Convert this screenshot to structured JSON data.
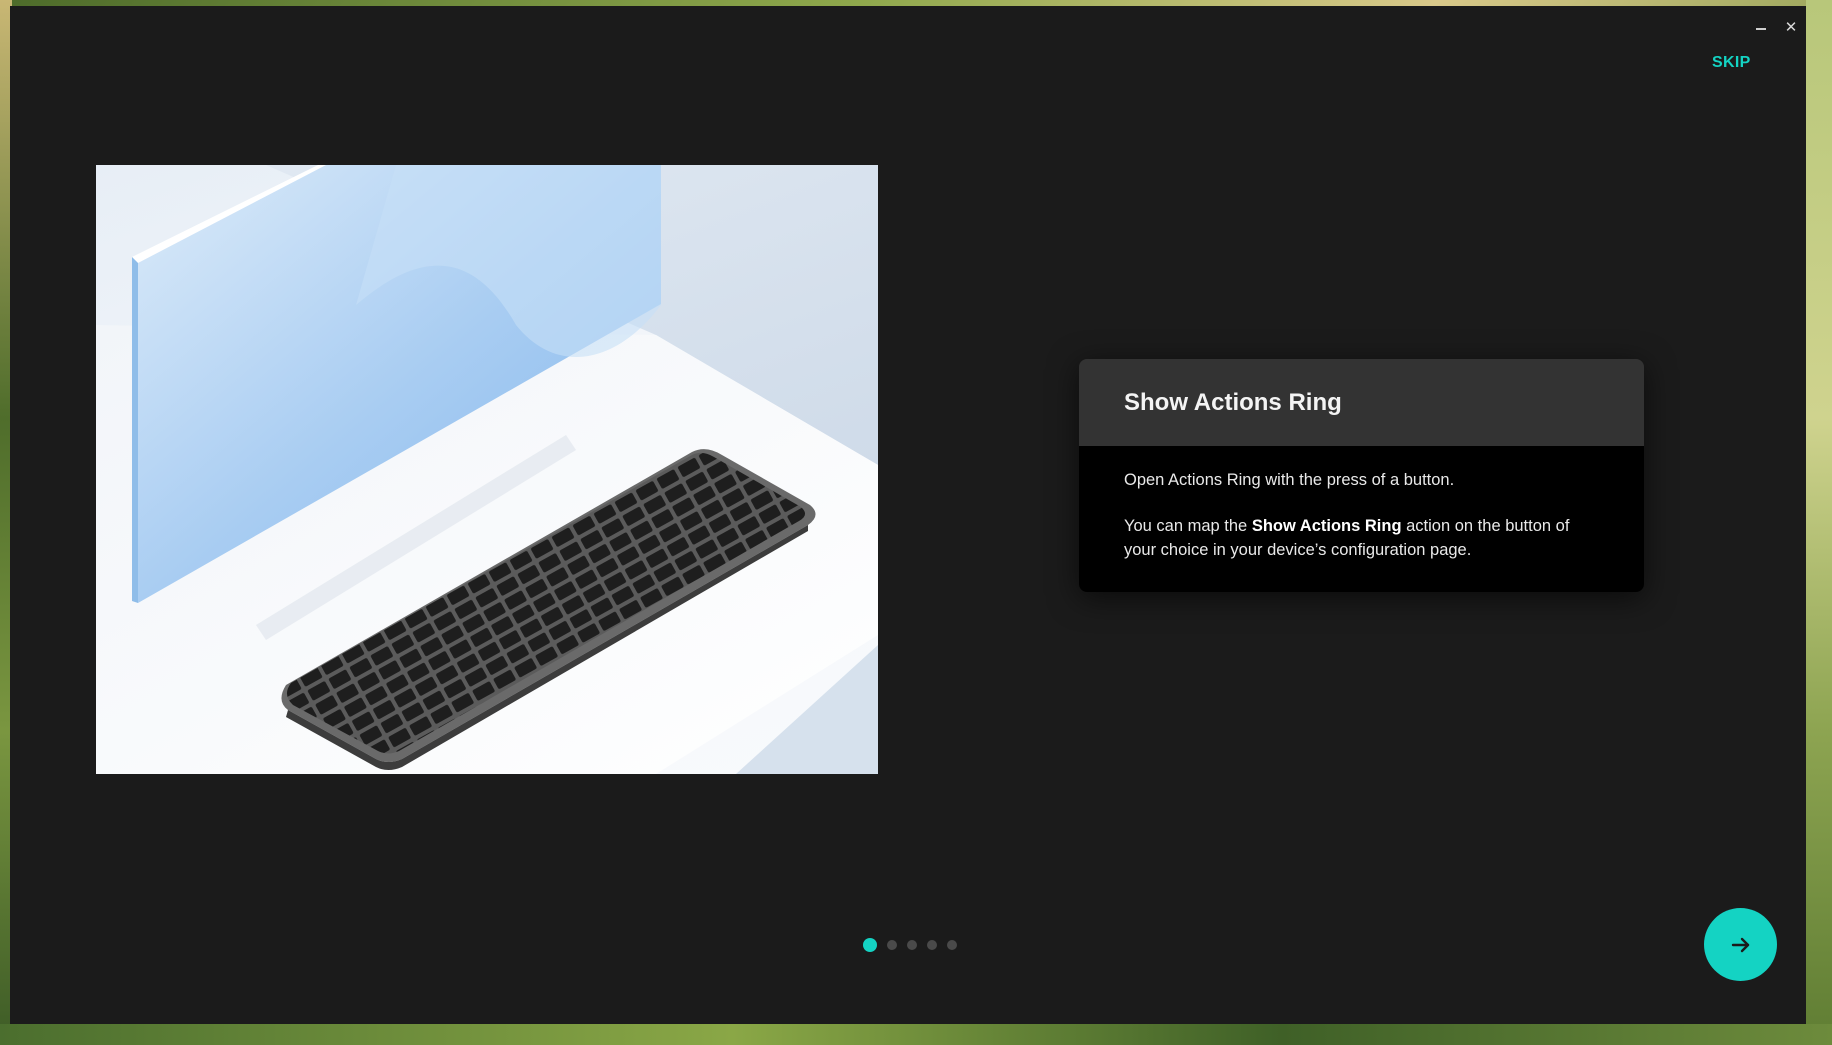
{
  "window": {
    "controls": {
      "minimize_icon": "minimize-icon",
      "close_icon": "close-icon",
      "close_glyph": "✕"
    }
  },
  "header": {
    "skip_label": "SKIP"
  },
  "illustration": {
    "icon": "keyboard-monitor-illustration"
  },
  "card": {
    "title": "Show Actions Ring",
    "body_line1": "Open Actions Ring with the press of a button.",
    "body_prefix": "You can map the ",
    "body_bold": "Show Actions Ring",
    "body_suffix": " action on the button of your choice in your device’s configuration page."
  },
  "pagination": {
    "total": 5,
    "current": 1
  },
  "next_button": {
    "icon": "arrow-right-icon"
  },
  "colors": {
    "accent": "#14d3c3",
    "background": "#1b1b1b",
    "card_header": "#333333",
    "card_body": "#000000"
  }
}
